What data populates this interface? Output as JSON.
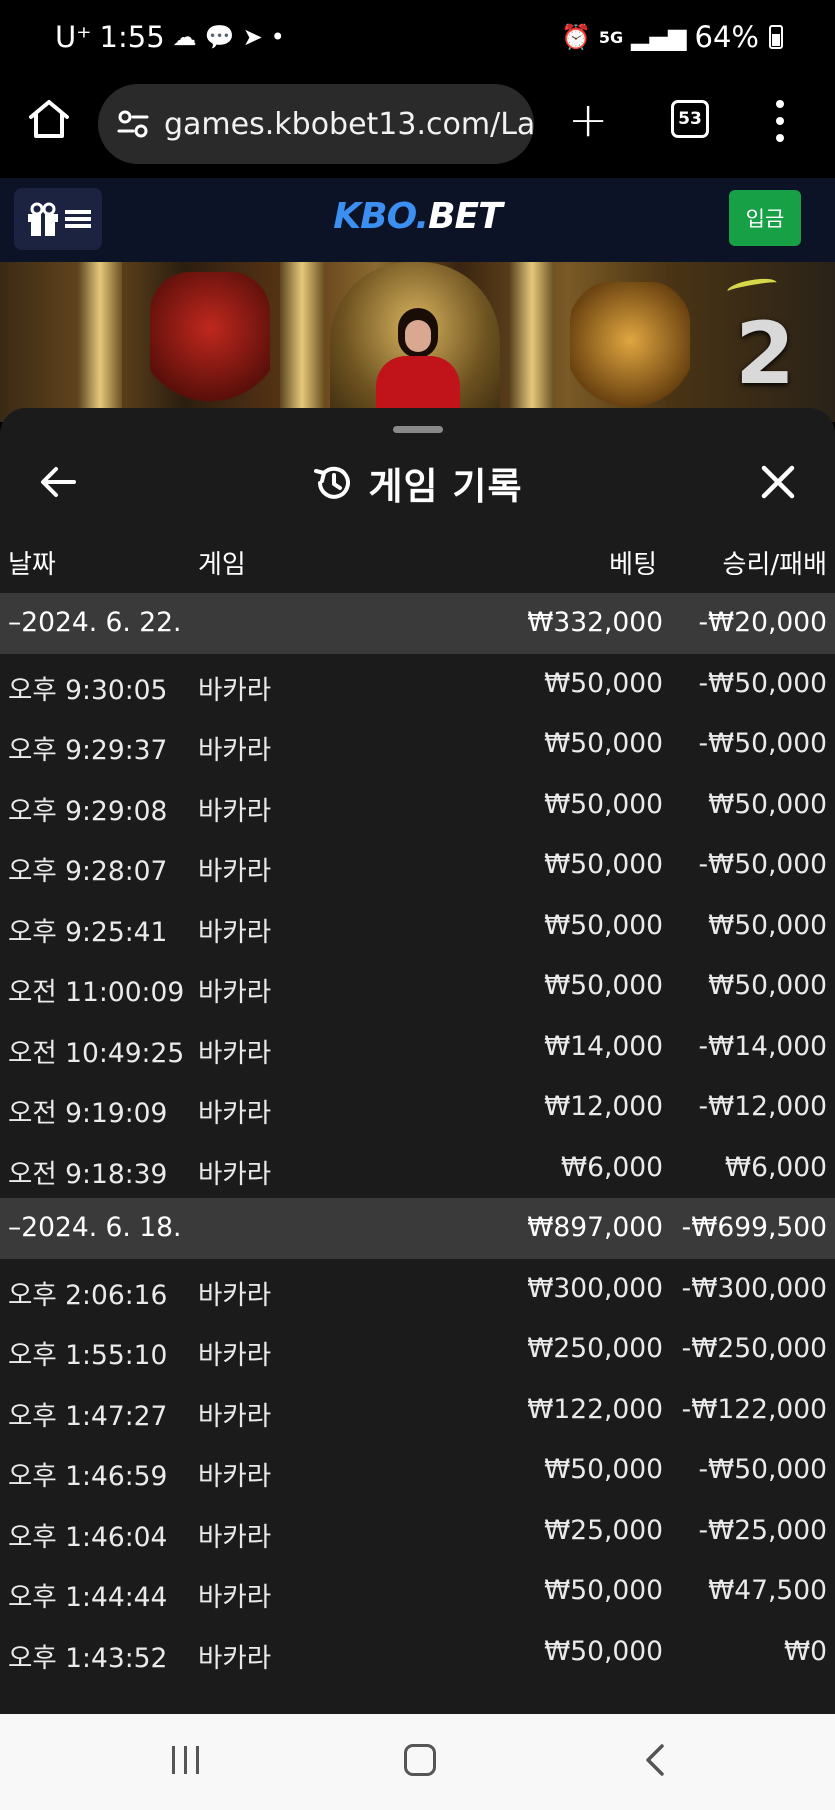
{
  "status_bar": {
    "carrier": "U⁺",
    "time": "1:55",
    "network": "5G",
    "battery": "64%"
  },
  "browser": {
    "url": "games.kbobet13.com/La",
    "tab_count": "53"
  },
  "site": {
    "logo_part1": "KBO.",
    "logo_part2": "BET",
    "deposit_label": "입금"
  },
  "banner": {
    "round_number": "2"
  },
  "history": {
    "title": "게임 기록",
    "columns": {
      "date": "날짜",
      "game": "게임",
      "bet": "베팅",
      "result": "승리/패배"
    },
    "rows": [
      {
        "type": "group",
        "date": "–2024. 6. 22.",
        "game": "",
        "bet": "₩332,000",
        "result": "-₩20,000"
      },
      {
        "type": "item",
        "date": "오후 9:30:05",
        "game": "바카라",
        "bet": "₩50,000",
        "result": "-₩50,000"
      },
      {
        "type": "item",
        "date": "오후 9:29:37",
        "game": "바카라",
        "bet": "₩50,000",
        "result": "-₩50,000"
      },
      {
        "type": "item",
        "date": "오후 9:29:08",
        "game": "바카라",
        "bet": "₩50,000",
        "result": "₩50,000"
      },
      {
        "type": "item",
        "date": "오후 9:28:07",
        "game": "바카라",
        "bet": "₩50,000",
        "result": "-₩50,000"
      },
      {
        "type": "item",
        "date": "오후 9:25:41",
        "game": "바카라",
        "bet": "₩50,000",
        "result": "₩50,000"
      },
      {
        "type": "item",
        "date": "오전 11:00:09",
        "game": "바카라",
        "bet": "₩50,000",
        "result": "₩50,000"
      },
      {
        "type": "item",
        "date": "오전 10:49:25",
        "game": "바카라",
        "bet": "₩14,000",
        "result": "-₩14,000"
      },
      {
        "type": "item",
        "date": "오전 9:19:09",
        "game": "바카라",
        "bet": "₩12,000",
        "result": "-₩12,000"
      },
      {
        "type": "item",
        "date": "오전 9:18:39",
        "game": "바카라",
        "bet": "₩6,000",
        "result": "₩6,000"
      },
      {
        "type": "group",
        "date": "–2024. 6. 18.",
        "game": "",
        "bet": "₩897,000",
        "result": "-₩699,500"
      },
      {
        "type": "item",
        "date": "오후 2:06:16",
        "game": "바카라",
        "bet": "₩300,000",
        "result": "-₩300,000"
      },
      {
        "type": "item",
        "date": "오후 1:55:10",
        "game": "바카라",
        "bet": "₩250,000",
        "result": "-₩250,000"
      },
      {
        "type": "item",
        "date": "오후 1:47:27",
        "game": "바카라",
        "bet": "₩122,000",
        "result": "-₩122,000"
      },
      {
        "type": "item",
        "date": "오후 1:46:59",
        "game": "바카라",
        "bet": "₩50,000",
        "result": "-₩50,000"
      },
      {
        "type": "item",
        "date": "오후 1:46:04",
        "game": "바카라",
        "bet": "₩25,000",
        "result": "-₩25,000"
      },
      {
        "type": "item",
        "date": "오후 1:44:44",
        "game": "바카라",
        "bet": "₩50,000",
        "result": "₩47,500"
      },
      {
        "type": "item",
        "date": "오후 1:43:52",
        "game": "바카라",
        "bet": "₩50,000",
        "result": "₩0"
      }
    ]
  },
  "colors": {
    "sheet_bg": "#1b1b1b",
    "group_row_bg": "#3a3a3a",
    "deposit_green": "#17a045",
    "logo_blue": "#3b8ff0"
  }
}
